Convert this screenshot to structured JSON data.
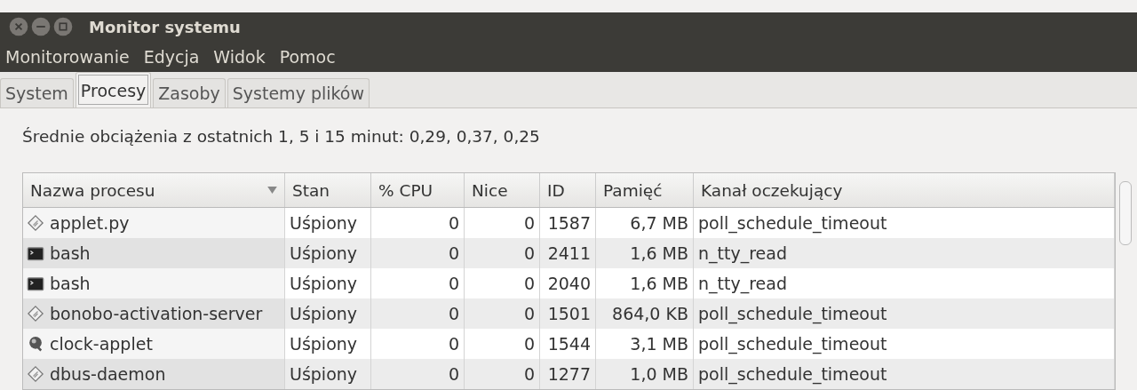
{
  "window": {
    "title": "Monitor systemu"
  },
  "menu": [
    "Monitorowanie",
    "Edycja",
    "Widok",
    "Pomoc"
  ],
  "tabs": [
    {
      "label": "System",
      "selected": false
    },
    {
      "label": "Procesy",
      "selected": true
    },
    {
      "label": "Zasoby",
      "selected": false
    },
    {
      "label": "Systemy plików",
      "selected": false
    }
  ],
  "load_average": "Średnie obciążenia z ostatnich 1, 5 i 15 minut: 0,29, 0,37, 0,25",
  "table": {
    "columns": [
      {
        "label": "Nazwa procesu",
        "sorted": true
      },
      {
        "label": "Stan",
        "sorted": false
      },
      {
        "label": "% CPU",
        "sorted": false
      },
      {
        "label": "Nice",
        "sorted": false
      },
      {
        "label": "ID",
        "sorted": false
      },
      {
        "label": "Pamięć",
        "sorted": false
      },
      {
        "label": "Kanał oczekujący",
        "sorted": false
      }
    ],
    "rows": [
      {
        "kind": "script",
        "cells": [
          "applet.py",
          "Uśpiony",
          "0",
          "0",
          "1587",
          "6,7 MB",
          "poll_schedule_timeout"
        ]
      },
      {
        "kind": "terminal",
        "cells": [
          "bash",
          "Uśpiony",
          "0",
          "0",
          "2411",
          "1,6 MB",
          "n_tty_read"
        ]
      },
      {
        "kind": "terminal",
        "cells": [
          "bash",
          "Uśpiony",
          "0",
          "0",
          "2040",
          "1,6 MB",
          "n_tty_read"
        ]
      },
      {
        "kind": "script",
        "cells": [
          "bonobo-activation-server",
          "Uśpiony",
          "0",
          "0",
          "1501",
          "864,0 KB",
          "poll_schedule_timeout"
        ]
      },
      {
        "kind": "ball",
        "cells": [
          "clock-applet",
          "Uśpiony",
          "0",
          "0",
          "1544",
          "3,1 MB",
          "poll_schedule_timeout"
        ]
      },
      {
        "kind": "script",
        "cells": [
          "dbus-daemon",
          "Uśpiony",
          "0",
          "0",
          "1277",
          "1,0 MB",
          "poll_schedule_timeout"
        ]
      }
    ]
  }
}
